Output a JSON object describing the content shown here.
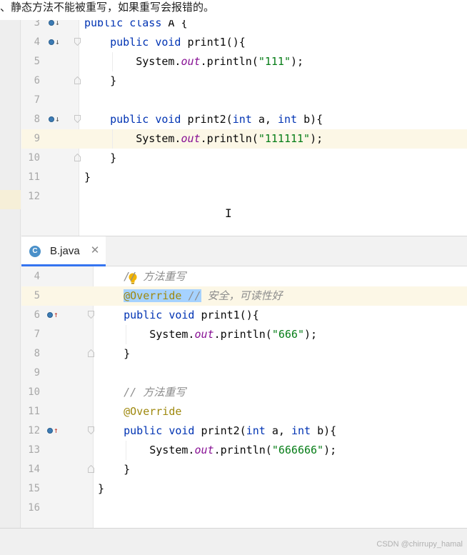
{
  "top_note": "、静态方法不能被重写，如果重写会报错的。",
  "editor_a": {
    "lines": [
      {
        "num": "3",
        "parts": [
          {
            "t": "public class ",
            "c": "kw"
          },
          {
            "t": "A {",
            "c": "plain"
          }
        ]
      },
      {
        "num": "4",
        "parts": [
          {
            "t": "    "
          },
          {
            "t": "public void ",
            "c": "kw"
          },
          {
            "t": "print1(){",
            "c": "plain"
          }
        ]
      },
      {
        "num": "5",
        "parts": [
          {
            "t": "        System.",
            "c": "plain"
          },
          {
            "t": "out",
            "c": "field"
          },
          {
            "t": ".println(",
            "c": "plain"
          },
          {
            "t": "\"111\"",
            "c": "str"
          },
          {
            "t": ");",
            "c": "plain"
          }
        ]
      },
      {
        "num": "6",
        "parts": [
          {
            "t": "    }",
            "c": "plain"
          }
        ]
      },
      {
        "num": "7",
        "parts": []
      },
      {
        "num": "8",
        "parts": [
          {
            "t": "    "
          },
          {
            "t": "public void ",
            "c": "kw"
          },
          {
            "t": "print2(",
            "c": "plain"
          },
          {
            "t": "int ",
            "c": "kw"
          },
          {
            "t": "a, ",
            "c": "plain"
          },
          {
            "t": "int ",
            "c": "kw"
          },
          {
            "t": "b){",
            "c": "plain"
          }
        ]
      },
      {
        "num": "9",
        "parts": [
          {
            "t": "        System.",
            "c": "plain"
          },
          {
            "t": "out",
            "c": "field"
          },
          {
            "t": ".println(",
            "c": "plain"
          },
          {
            "t": "\"111111\"",
            "c": "str"
          },
          {
            "t": ");",
            "c": "plain"
          }
        ]
      },
      {
        "num": "10",
        "parts": [
          {
            "t": "    }",
            "c": "plain"
          }
        ]
      },
      {
        "num": "11",
        "parts": [
          {
            "t": "}",
            "c": "plain"
          }
        ]
      },
      {
        "num": "12",
        "parts": []
      }
    ]
  },
  "tab": {
    "icon_letter": "C",
    "label": "B.java",
    "close_glyph": "✕"
  },
  "editor_b": {
    "lines": [
      {
        "num": "4",
        "parts": [
          {
            "t": "    "
          },
          {
            "t": "// 方法重写",
            "c": "cmt"
          }
        ]
      },
      {
        "num": "5",
        "parts": [
          {
            "t": "    "
          },
          {
            "t": "@Override",
            "c": "ann sel"
          },
          {
            "t": " ",
            "c": "sel"
          },
          {
            "t": "//",
            "c": "cmt sel"
          },
          {
            "t": " 安全，可读性好",
            "c": "cmt"
          }
        ]
      },
      {
        "num": "6",
        "parts": [
          {
            "t": "    "
          },
          {
            "t": "public void ",
            "c": "kw"
          },
          {
            "t": "print1(){",
            "c": "plain"
          }
        ]
      },
      {
        "num": "7",
        "parts": [
          {
            "t": "        System.",
            "c": "plain"
          },
          {
            "t": "out",
            "c": "field"
          },
          {
            "t": ".println(",
            "c": "plain"
          },
          {
            "t": "\"666\"",
            "c": "str"
          },
          {
            "t": ");",
            "c": "plain"
          }
        ]
      },
      {
        "num": "8",
        "parts": [
          {
            "t": "    }",
            "c": "plain"
          }
        ]
      },
      {
        "num": "9",
        "parts": []
      },
      {
        "num": "10",
        "parts": [
          {
            "t": "    "
          },
          {
            "t": "// 方法重写",
            "c": "cmt"
          }
        ]
      },
      {
        "num": "11",
        "parts": [
          {
            "t": "    "
          },
          {
            "t": "@Override",
            "c": "ann"
          }
        ]
      },
      {
        "num": "12",
        "parts": [
          {
            "t": "    "
          },
          {
            "t": "public void ",
            "c": "kw"
          },
          {
            "t": "print2(",
            "c": "plain"
          },
          {
            "t": "int ",
            "c": "kw"
          },
          {
            "t": "a, ",
            "c": "plain"
          },
          {
            "t": "int ",
            "c": "kw"
          },
          {
            "t": "b){",
            "c": "plain"
          }
        ]
      },
      {
        "num": "13",
        "parts": [
          {
            "t": "        System.",
            "c": "plain"
          },
          {
            "t": "out",
            "c": "field"
          },
          {
            "t": ".println(",
            "c": "plain"
          },
          {
            "t": "\"666666\"",
            "c": "str"
          },
          {
            "t": ");",
            "c": "plain"
          }
        ]
      },
      {
        "num": "14",
        "parts": [
          {
            "t": "    }",
            "c": "plain"
          }
        ]
      },
      {
        "num": "15",
        "parts": [
          {
            "t": "}",
            "c": "plain"
          }
        ]
      },
      {
        "num": "16",
        "parts": []
      }
    ]
  },
  "gutter_icons": {
    "overridden_icon": "overridden-method-icon",
    "overriding_icon": "overriding-method-icon",
    "intention_icon": "lightbulb-icon"
  },
  "cursor_glyph": "I",
  "watermark": "CSDN @chirrupy_hamal",
  "colors": {
    "keyword": "#0033b3",
    "string": "#067d17",
    "static_field": "#871094",
    "annotation": "#9e880d",
    "comment": "#8c8c8c",
    "selection": "#a6d2ff",
    "current_line": "#fcf7e6",
    "tab_underline": "#3574f0"
  }
}
